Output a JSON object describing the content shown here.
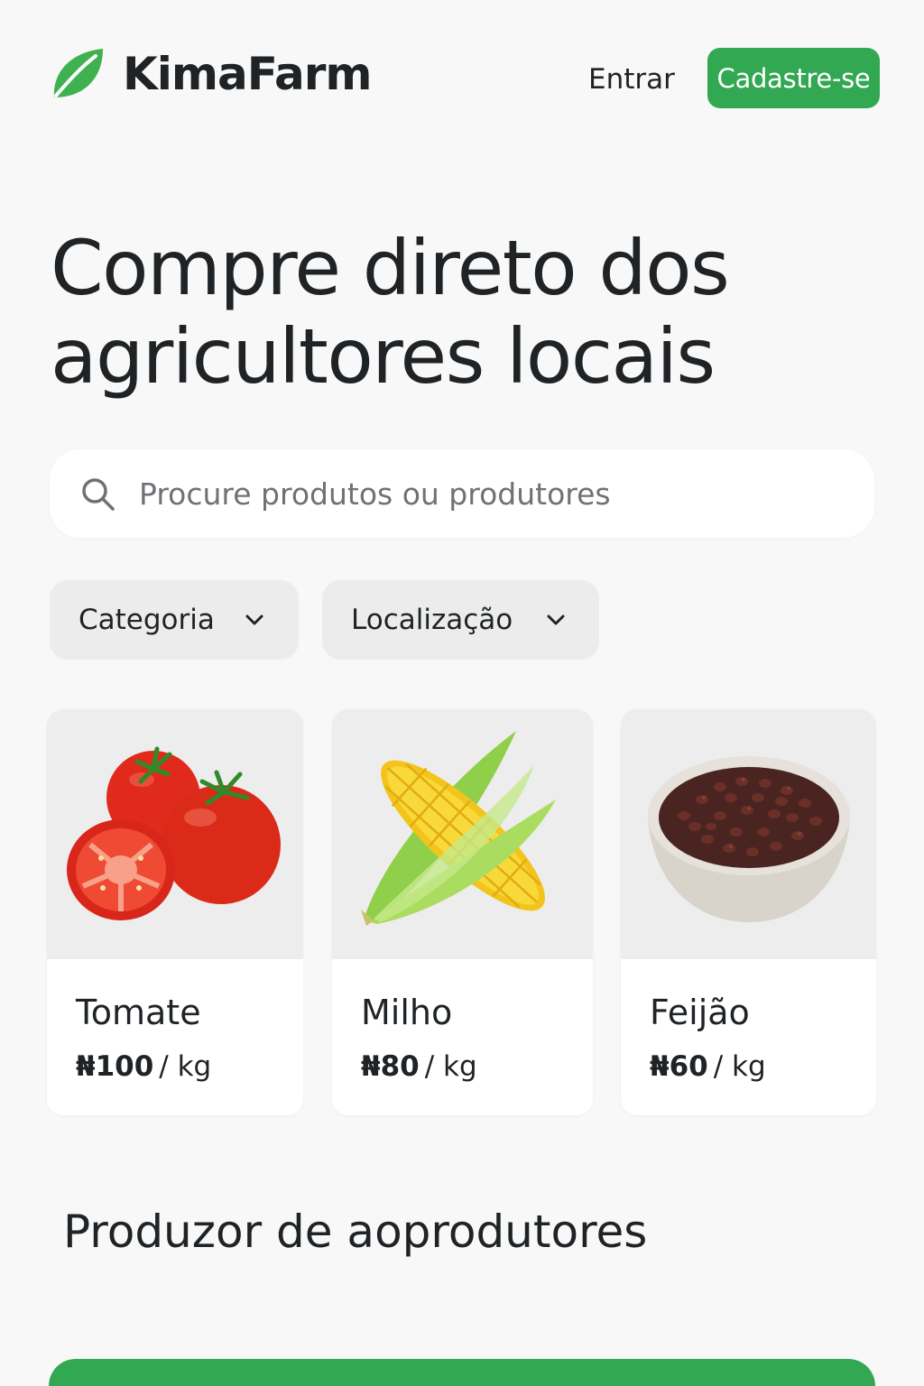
{
  "header": {
    "brand": "KimaFarm",
    "login_label": "Entrar",
    "signup_label": "Cadastre-se",
    "accent_color": "#32a852"
  },
  "hero": {
    "title": "Compre direto dos agricultores locais"
  },
  "search": {
    "placeholder": "Procure produtos ou produtores",
    "icon": "search-icon"
  },
  "filters": [
    {
      "label": "Categoria",
      "icon": "chevron-down-icon"
    },
    {
      "label": "Localização",
      "icon": "chevron-down-icon"
    }
  ],
  "products": [
    {
      "name": "Tomate",
      "price": "₦100",
      "unit": "/ kg",
      "image": "tomato-image"
    },
    {
      "name": "Milho",
      "price": "₦80",
      "unit": "/ kg",
      "image": "corn-image"
    },
    {
      "name": "Feijão",
      "price": "₦60",
      "unit": "/ kg",
      "image": "beans-bowl-image"
    }
  ],
  "section": {
    "title": "Produzor de aoprodutores"
  }
}
